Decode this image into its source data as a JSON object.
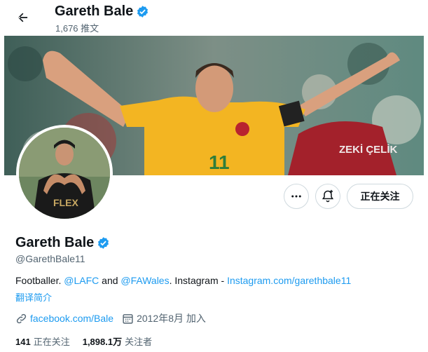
{
  "header": {
    "name": "Gareth Bale",
    "tweet_count": "1,676 推文"
  },
  "icons": {
    "back": "arrow-left-icon",
    "verified": "verified-badge-icon",
    "more": "more-horizontal-icon",
    "notify": "bell-plus-icon",
    "link": "link-icon",
    "calendar": "calendar-icon"
  },
  "actions": {
    "follow_label": "正在关注"
  },
  "profile": {
    "name": "Gareth Bale",
    "handle": "@GarethBale11",
    "bio": {
      "prefix": "Footballer. ",
      "mention1": "@LAFC",
      "and": " and ",
      "mention2": "@FAWales",
      "middle": ". Instagram - ",
      "ig_link": "Instagram.com/garethbale11"
    },
    "translate_label": "翻译简介",
    "website": "facebook.com/Bale",
    "joined": "2012年8月 加入"
  },
  "stats": {
    "following_count": "141",
    "following_label": "正在关注",
    "followers_count": "1,898.1万",
    "followers_label": "关注者"
  },
  "colors": {
    "accent": "#1d9bf0",
    "text": "#0f1419",
    "muted": "#536471"
  },
  "banner_text": {
    "jersey_number": "11",
    "opponent_name": "ZEKİ ÇELİK"
  },
  "avatar_text": {
    "shirt": "FLEX"
  }
}
